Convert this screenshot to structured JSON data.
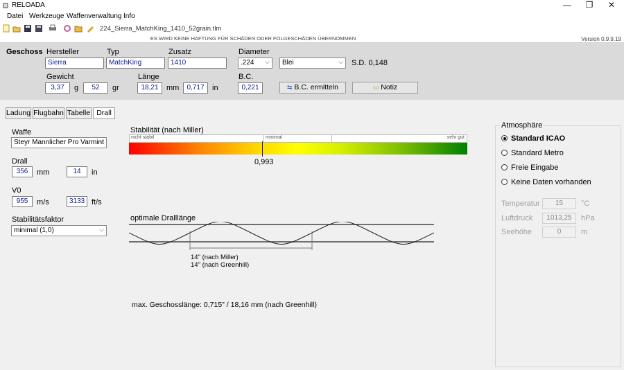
{
  "app": {
    "title": "RELOADA",
    "filename": "224_Sierra_MatchKing_1410_52grain.tlm"
  },
  "window": {
    "minimize": "—",
    "restore": "❐",
    "close": "✕"
  },
  "menu": [
    "Datei",
    "Werkzeuge",
    "Waffenverwaltung",
    "Info"
  ],
  "toolbar_icons": [
    "new-icon",
    "open-icon",
    "save-icon",
    "save-all-icon",
    "print-icon",
    "settings-icon",
    "folder-icon",
    "edit-icon"
  ],
  "disclaimer": "ES WIRD KEINE HAFTUNG FÜR SCHÄDEN ODER FOLGESCHÄDEN ÜBERNOMMEN",
  "version": "Version 0.9.9.19",
  "geschoss": {
    "heading": "Geschoss",
    "hersteller_label": "Hersteller",
    "hersteller": "Sierra",
    "typ_label": "Typ",
    "typ": "MatchKing",
    "zusatz_label": "Zusatz",
    "zusatz": "1410",
    "diameter_label": "Diameter",
    "diameter": ".224",
    "material": "Blei",
    "sd": "S.D. 0,148",
    "gewicht_label": "Gewicht",
    "gewicht_g": "3,37",
    "gewicht_g_unit": "g",
    "gewicht_gr": "52",
    "gewicht_gr_unit": "gr",
    "laenge_label": "Länge",
    "laenge_mm": "18,21",
    "laenge_mm_unit": "mm",
    "laenge_in": "0,717",
    "laenge_in_unit": "in",
    "bc_label": "B.C.",
    "bc": "0,221",
    "bc_button": "B.C. ermitteln",
    "notiz_button": "Notiz"
  },
  "tabs": [
    "Ladung",
    "Flugbahn",
    "Tabelle",
    "Drall"
  ],
  "left": {
    "waffe_label": "Waffe",
    "waffe": "Steyr Mannlicher Pro Varmint",
    "drall_label": "Drall",
    "drall_mm": "356",
    "drall_mm_unit": "mm",
    "drall_in": "14",
    "drall_in_unit": "in",
    "v0_label": "V0",
    "v0_ms": "955",
    "v0_ms_unit": "m/s",
    "v0_fts": "3133",
    "v0_fts_unit": "ft/s",
    "stab_label": "Stabilitätsfaktor",
    "stab": "minimal (1,0)"
  },
  "stability": {
    "title": "Stabilität (nach Miller)",
    "zone_left": "nicht stabil",
    "zone_mid": "minimal",
    "zone_right": "sehr gut",
    "value": "0,993"
  },
  "twist": {
    "title": "optimale Dralllänge",
    "miller": "14\" (nach Miller)",
    "greenhill": "14\" (nach Greenhill)",
    "max_length": "max. Geschosslänge: 0,715\" / 18,16 mm (nach Greenhill)"
  },
  "atmosphere": {
    "title": "Atmosphäre",
    "options": [
      "Standard ICAO",
      "Standard Metro",
      "Freie Eingabe",
      "Keine Daten vorhanden"
    ],
    "selected_index": 0,
    "temp_label": "Temperatur",
    "temp": "15",
    "temp_unit": "°C",
    "druck_label": "Luftdruck",
    "druck": "1013,25",
    "druck_unit": "hPa",
    "hoehe_label": "Seehöhe",
    "hoehe": "0",
    "hoehe_unit": "m"
  },
  "colors": {
    "bar_red": "#ff0000",
    "bar_yellow": "#ffff00",
    "bar_green": "#008000",
    "value_text": "#0b1c8e"
  }
}
